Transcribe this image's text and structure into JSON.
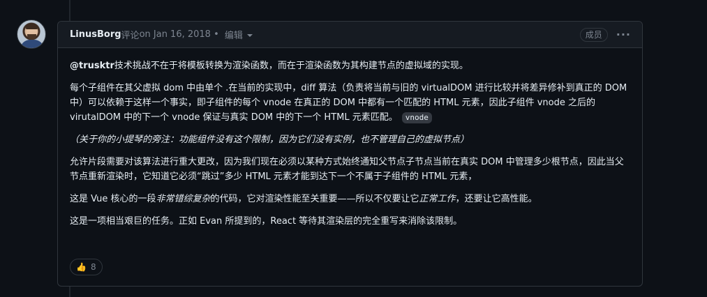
{
  "comment": {
    "author": "LinusBorg",
    "action": "评论",
    "date": "on Jan 16, 2018",
    "separator": " • ",
    "edited": "编辑",
    "badge": "成员",
    "more": "···",
    "body": {
      "p1_mention": "@trusktr",
      "p1_text": "技术挑战不在于将模板转换为渲染函数，而在于渲染函数为其构建节点的虚拟域的实现。",
      "p2_text": "每个子组件在其父虚拟 dom 中由单个 .在当前的实现中，diff 算法（负责将当前与旧的 virtualDOM 进行比较并将差异修补到真正的 DOM 中）可以依赖于这样一个事实，即子组件的每个 vnode 在真正的 DOM 中都有一个匹配的 HTML 元素，因此子组件 vnode 之后的 virutalDOM 中的下一个 vnode 保证与真实 DOM 中的下一个 HTML 元素匹配。",
      "p2_chip": "vnode",
      "p3_text": "（关于你的小提琴的旁注：功能组件没有这个限制，因为它们没有实例，也不管理自己的虚拟节点）",
      "p4_text": "允许片段需要对该算法进行重大更改，因为我们现在必须以某种方式始终通知父节点子节点当前在真实 DOM 中管理多少根节点，因此当父节点重新渲染时，它知道它必须“跳过”多少 HTML 元素才能到达下一个不属于子组件的 HTML 元素，",
      "p5_a": "这是 Vue 核心的一段",
      "p5_italic1": "非常错综复杂",
      "p5_b": "的代码，它对渲染性能至关重要——所以不仅要让它",
      "p5_italic2": "正常工作",
      "p5_c": "，还要让它高性能。",
      "p6_text": "这是一项相当艰巨的任务。正如 Evan 所提到的，React 等待其渲染层的完全重写来消除该限制。"
    },
    "reaction": {
      "emoji": "👍",
      "count": "8"
    }
  }
}
